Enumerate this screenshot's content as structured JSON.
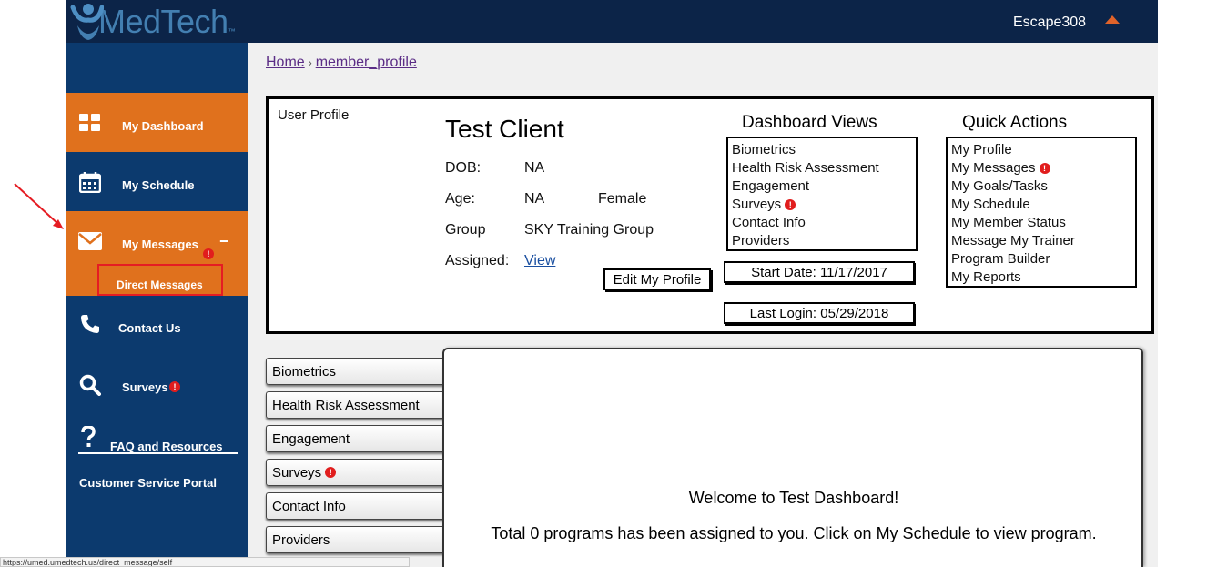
{
  "header": {
    "logo_text": "MedTech",
    "logo_tm": "™",
    "username": "Escape308",
    "colors": {
      "topbar": "#0c2448",
      "accent": "#e0632a"
    }
  },
  "sidebar": {
    "items": [
      {
        "label": "My Dashboard",
        "icon": "dashboard-grid-icon"
      },
      {
        "label": "My Schedule",
        "icon": "calendar-icon"
      },
      {
        "label": "My Messages",
        "icon": "envelope-icon",
        "collapse": "−"
      },
      {
        "label": "Direct Messages"
      },
      {
        "label": "Contact Us",
        "icon": "phone-icon"
      },
      {
        "label": "Surveys",
        "icon": "search-icon"
      },
      {
        "label": "FAQ and Resources",
        "icon": "question-icon"
      },
      {
        "label": "Customer Service Portal"
      }
    ],
    "badge": "!",
    "colors": {
      "bg": "#0c3a6e",
      "active": "#e0711d"
    }
  },
  "breadcrumb": {
    "home": "Home",
    "sep": "›",
    "current": "member_profile"
  },
  "profile": {
    "section_title": "User Profile",
    "name": "Test Client",
    "fields": {
      "dob_label": "DOB:",
      "dob_value": "NA",
      "age_label": "Age:",
      "age_value": "NA",
      "gender": "Female",
      "group_label": "Group",
      "group_value": "SKY Training Group",
      "assigned_label": "Assigned:",
      "assigned_link": "View"
    },
    "edit_button": "Edit My Profile"
  },
  "dashboard_views": {
    "title": "Dashboard Views",
    "items": [
      "Biometrics",
      "Health Risk Assessment",
      "Engagement",
      "Surveys",
      "Contact Info",
      "Providers"
    ]
  },
  "dates": {
    "start": "Start Date: 11/17/2017",
    "last_login": "Last Login: 05/29/2018"
  },
  "quick_actions": {
    "title": "Quick Actions",
    "items": [
      "My Profile",
      "My Messages",
      "My Goals/Tasks",
      "My Schedule",
      "My Member Status",
      "Message My Trainer",
      "Program Builder",
      "My Reports"
    ]
  },
  "tabs": [
    "Biometrics",
    "Health Risk Assessment",
    "Engagement",
    "Surveys",
    "Contact Info",
    "Providers"
  ],
  "content": {
    "welcome": "Welcome to Test Dashboard!",
    "programs": "Total 0 programs has been assigned to you. Click on My Schedule to view program."
  },
  "statusbar": {
    "url": "https://umed.umedtech.us/direct_message/self"
  }
}
